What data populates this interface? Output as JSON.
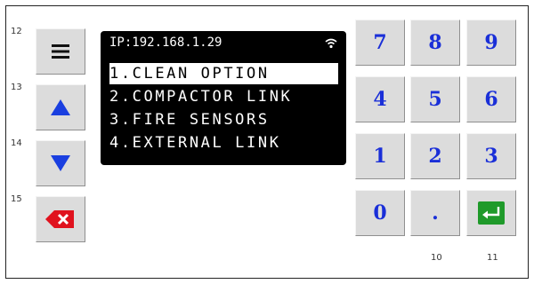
{
  "side_key_numbers": [
    "12",
    "13",
    "14",
    "15"
  ],
  "side_keys": [
    {
      "icon": "menu-icon"
    },
    {
      "icon": "arrow-up-icon"
    },
    {
      "icon": "arrow-down-icon"
    },
    {
      "icon": "backspace-icon"
    }
  ],
  "display": {
    "ip": "IP:192.168.1.29",
    "wifi_icon": "wifi-icon",
    "menu": [
      {
        "label": "1.CLEAN OPTION",
        "selected": true
      },
      {
        "label": "2.COMPACTOR LINK",
        "selected": false
      },
      {
        "label": "3.FIRE SENSORS",
        "selected": false
      },
      {
        "label": "4.EXTERNAL LINK",
        "selected": false
      }
    ]
  },
  "keypad": {
    "digits": [
      "7",
      "8",
      "9",
      "4",
      "5",
      "6",
      "1",
      "2",
      "3",
      "0",
      "."
    ],
    "enter_icon": "enter-icon"
  },
  "bottom_key_numbers": [
    "10",
    "11"
  ],
  "colors": {
    "digit": "#1a2fd8",
    "arrow": "#1a3fe0",
    "backspace": "#e0121e",
    "enter": "#1f9a2a",
    "key_face": "#dcdcdc",
    "lcd": "#000000"
  }
}
